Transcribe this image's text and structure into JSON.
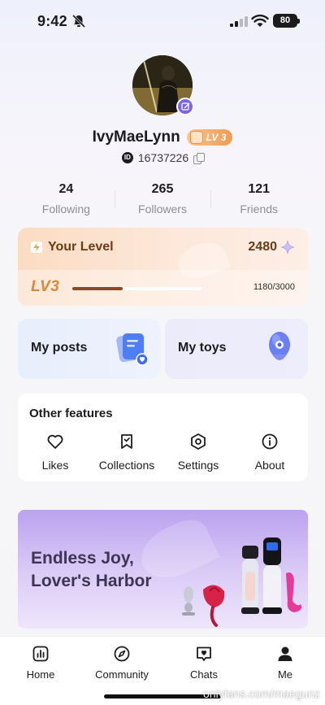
{
  "status_bar": {
    "time": "9:42",
    "battery": "80"
  },
  "profile": {
    "username": "IvyMaeLynn",
    "level_badge": "LV 3",
    "id_chip": "ID",
    "user_id": "16737226"
  },
  "stats": [
    {
      "value": "24",
      "label": "Following"
    },
    {
      "value": "265",
      "label": "Followers"
    },
    {
      "value": "121",
      "label": "Friends"
    }
  ],
  "level_card": {
    "title": "Your Level",
    "points": "2480",
    "level_logo": "LV3",
    "progress_text": "1180/3000",
    "progress_fraction": 0.39
  },
  "tiles": {
    "posts_label": "My posts",
    "toys_label": "My toys"
  },
  "features": {
    "title": "Other features",
    "items": [
      {
        "label": "Likes",
        "icon": "heart-icon"
      },
      {
        "label": "Collections",
        "icon": "bookmark-icon"
      },
      {
        "label": "Settings",
        "icon": "settings-icon"
      },
      {
        "label": "About",
        "icon": "info-icon"
      }
    ]
  },
  "banner": {
    "line1": "Endless Joy,",
    "line2": "Lover's Harbor"
  },
  "tab_bar": [
    {
      "label": "Home",
      "icon": "chart-icon"
    },
    {
      "label": "Community",
      "icon": "compass-icon"
    },
    {
      "label": "Chats",
      "icon": "chat-heart-icon"
    },
    {
      "label": "Me",
      "icon": "person-icon"
    }
  ],
  "watermark": "onlyfans.com/maegunz",
  "colors": {
    "accent": "#7b64e8",
    "level_brown": "#6b3b16",
    "level_orange": "#f29a52",
    "banner_purple": "#bba2ef"
  }
}
